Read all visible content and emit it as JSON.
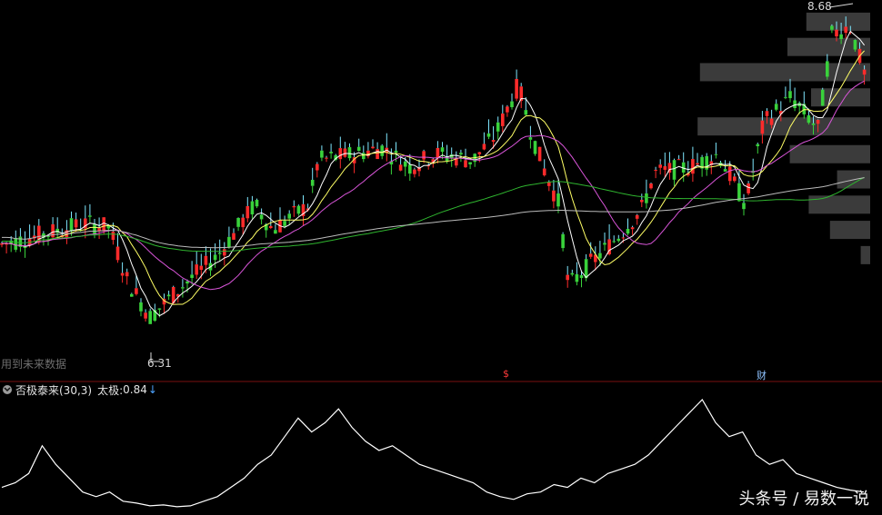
{
  "chart_data": {
    "type": "candlestick",
    "price_range": [
      6.0,
      8.75
    ],
    "labels": {
      "low_marker": "6.31",
      "high_marker": "8.68",
      "future_data_note": "用到未来数据",
      "marker_s": "$",
      "marker_cai": "财"
    },
    "indicator": {
      "name": "否极泰来(30,3)",
      "series_name": "太极:",
      "value": "0.84",
      "arrow": "↓",
      "range": [
        0,
        1.2
      ],
      "values": [
        0.25,
        0.3,
        0.4,
        0.7,
        0.5,
        0.35,
        0.2,
        0.15,
        0.2,
        0.1,
        0.08,
        0.05,
        0.06,
        0.04,
        0.05,
        0.1,
        0.15,
        0.25,
        0.35,
        0.5,
        0.6,
        0.8,
        1.0,
        0.85,
        0.95,
        1.1,
        0.9,
        0.75,
        0.65,
        0.7,
        0.6,
        0.5,
        0.45,
        0.4,
        0.35,
        0.3,
        0.2,
        0.15,
        0.12,
        0.18,
        0.2,
        0.28,
        0.25,
        0.35,
        0.3,
        0.4,
        0.45,
        0.5,
        0.6,
        0.75,
        0.9,
        1.05,
        1.2,
        0.95,
        0.8,
        0.85,
        0.6,
        0.5,
        0.55,
        0.4,
        0.35,
        0.3,
        0.25,
        0.22,
        0.2
      ]
    },
    "moving_average_colors": [
      "#ffffff",
      "#ffff66",
      "#d955d9",
      "#2fb52f",
      "#bbbbbb"
    ],
    "colors": {
      "up": "#ff2b2b",
      "down": "#39d23b",
      "upper_shadow": "#7fe8ff"
    },
    "volume_profile": [
      {
        "price": 8.65,
        "rel": 0.27
      },
      {
        "price": 8.45,
        "rel": 0.35
      },
      {
        "price": 8.25,
        "rel": 0.72
      },
      {
        "price": 8.05,
        "rel": 0.25
      },
      {
        "price": 7.82,
        "rel": 0.73
      },
      {
        "price": 7.6,
        "rel": 0.34
      },
      {
        "price": 7.4,
        "rel": 0.14
      },
      {
        "price": 7.2,
        "rel": 0.26
      },
      {
        "price": 7.0,
        "rel": 0.17
      },
      {
        "price": 6.8,
        "rel": 0.04
      }
    ],
    "watermark": "头条号 / 易数一说"
  }
}
